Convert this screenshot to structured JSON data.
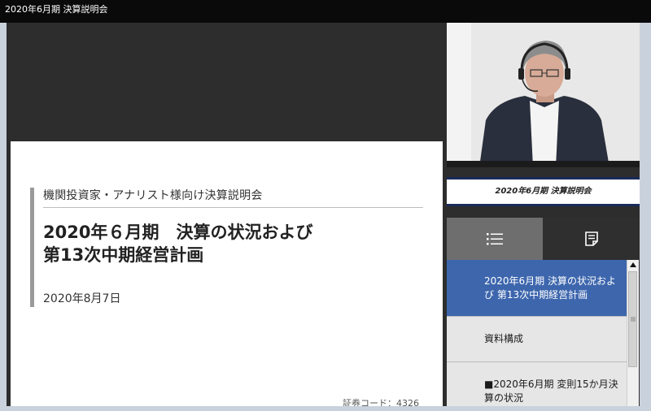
{
  "window": {
    "title": "2020年6月期 決算説明会"
  },
  "slide": {
    "subtitle": "機関投資家・アナリスト様向け決算説明会",
    "title_line1": "2020年６月期　決算の状況および",
    "title_line2": "第13次中期経営計画",
    "date": "2020年8月7日",
    "code": "証券コード：4326"
  },
  "video": {
    "caption": "2020年6月期 決算説明会"
  },
  "tabs": [
    {
      "name": "chapter-list",
      "icon": "list-icon"
    },
    {
      "name": "document",
      "icon": "document-icon"
    }
  ],
  "chapters": [
    {
      "label": "2020年6月期 決算の状況および 第13次中期経営計画",
      "active": true
    },
    {
      "label": "資料構成",
      "active": false
    },
    {
      "label": "■2020年6月期 変則15か月決算の状況",
      "active": false
    }
  ],
  "colors": {
    "title_bar": "#0a0a0a",
    "panel_bg": "#2d2d2d",
    "active_item": "#3d66ad",
    "caption_border": "#1a2a5a",
    "tab_selected": "#6e6e6e"
  }
}
